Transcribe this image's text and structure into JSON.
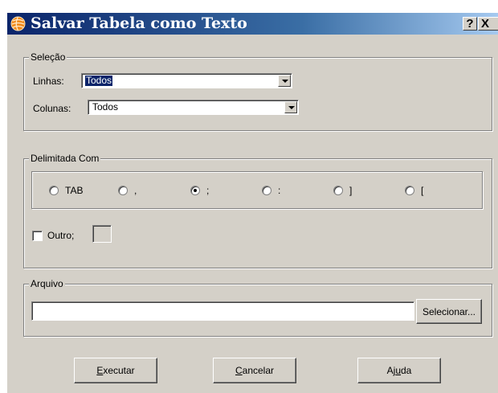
{
  "window": {
    "title": "Salvar Tabela como Texto",
    "help_glyph": "?",
    "close_glyph": "X",
    "accent_color": "#0a246a",
    "face_color": "#d4d0c8"
  },
  "selecao": {
    "legend": "Seleção",
    "linhas_label": "Linhas:",
    "linhas_value": "Todos",
    "colunas_label": "Colunas:",
    "colunas_value": "Todos"
  },
  "delimitada": {
    "legend": "Delimitada Com",
    "options": [
      {
        "label": "TAB",
        "selected": false
      },
      {
        "label": ",",
        "selected": false
      },
      {
        "label": ";",
        "selected": true
      },
      {
        "label": ":",
        "selected": false
      },
      {
        "label": "]",
        "selected": false
      },
      {
        "label": "[",
        "selected": false
      }
    ],
    "outro_label": "Outro;",
    "outro_checked": false,
    "outro_value": ""
  },
  "arquivo": {
    "legend": "Arquivo",
    "path_value": "",
    "select_button": "Selecionar..."
  },
  "buttons": {
    "executar_mnemonic": "E",
    "executar_rest": "xecutar",
    "cancelar_mnemonic": "C",
    "cancelar_rest": "ancelar",
    "ajuda_prefix": "Aj",
    "ajuda_mnemonic": "u",
    "ajuda_rest": "da"
  },
  "icons": {
    "app": "globe-icon",
    "dropdown": "chevron-down-icon"
  }
}
